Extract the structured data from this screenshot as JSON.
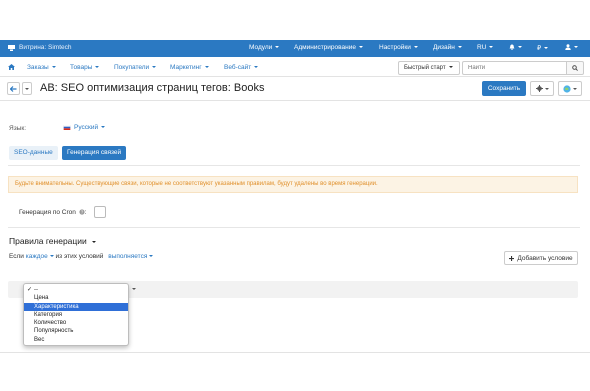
{
  "topbar": {
    "store_label": "Витрина: Simtech",
    "menus": [
      "Модули",
      "Администрирование",
      "Настройки",
      "Дизайн"
    ],
    "language": "RU",
    "currency": "₽"
  },
  "navbar": {
    "items": [
      "Заказы",
      "Товары",
      "Покупатели",
      "Маркетинг",
      "Веб-сайт"
    ],
    "quick_start": "Быстрый старт",
    "search_placeholder": "Найти"
  },
  "titlebar": {
    "title": "AB: SEO оптимизация страниц тегов: Books",
    "save_label": "Сохранить"
  },
  "language_field": {
    "label": "Язык:",
    "value": "Русский"
  },
  "tabs": [
    {
      "label": "SEO-данные",
      "active": false
    },
    {
      "label": "Генерация связей",
      "active": true
    }
  ],
  "alert": {
    "text": "Будьте внимательны. Существующие связи, которые не соответствуют указанным правилам, будут удалены во время генерации."
  },
  "cron": {
    "label": "Генерация по Cron",
    "checked": false
  },
  "rules": {
    "title": "Правила генерации",
    "condition_prefix": "Если",
    "condition_mode": "каждое",
    "condition_middle": "из этих условий",
    "condition_state": "выполняется",
    "add_condition_label": "Добавить условие"
  },
  "dropdown": {
    "options": [
      "--",
      "Цена",
      "Характеристика",
      "Категория",
      "Количество",
      "Популярность",
      "Вес"
    ],
    "checked": "--",
    "highlighted": "Характеристика"
  },
  "colors": {
    "accent": "#2b79c2",
    "alert_bg": "#fcf3e4",
    "alert_text": "#e0902c",
    "highlight": "#2f6fd7"
  }
}
